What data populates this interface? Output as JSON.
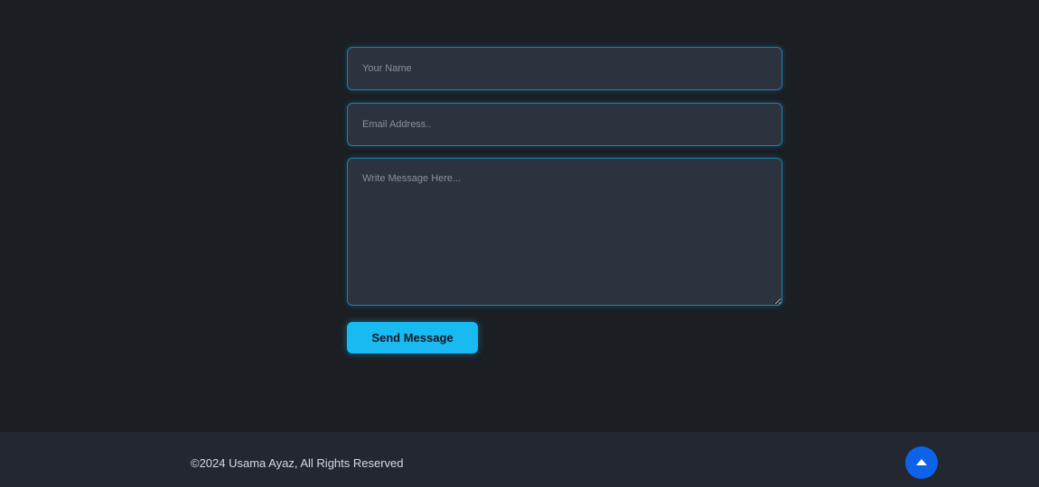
{
  "contact_form": {
    "name_placeholder": "Your Name",
    "email_placeholder": "Email Address..",
    "message_placeholder": "Write Message Here...",
    "send_label": "Send Message"
  },
  "footer": {
    "copyright": "©2024 Usama Ayaz, All Rights Reserved",
    "back_to_top_icon": "caret-up-icon"
  },
  "colors": {
    "page_background": "#1b1e23",
    "field_background": "#2d323f",
    "field_border": "#1d7fa8",
    "accent_button": "#19b9f2",
    "footer_background": "#222731",
    "back_to_top": "#0d63e8"
  }
}
